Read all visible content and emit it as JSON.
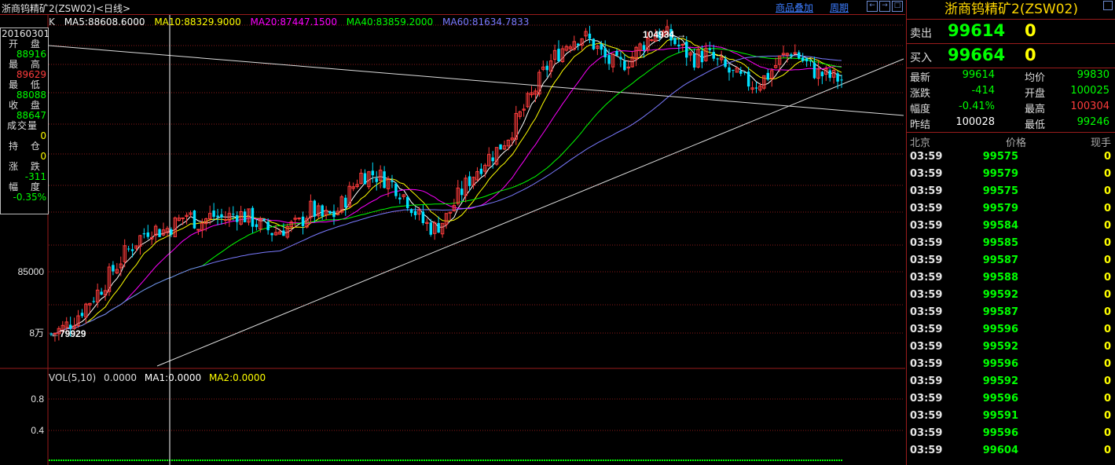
{
  "header": {
    "title": "浙商钨精矿2(ZSW02)<日线>",
    "link_overlay": "商品叠加",
    "link_period": "周期",
    "btn_prev": "←",
    "btn_next": "→",
    "btn_close": "□"
  },
  "legend": {
    "k": "K",
    "ma5": "MA5:88608.6000",
    "ma10": "MA10:88329.9000",
    "ma20": "MA20:87447.1500",
    "ma40": "MA40:83859.2000",
    "ma60": "MA60:81634.7833"
  },
  "colors": {
    "up": "#ff3c3c",
    "down": "#00e0ff",
    "ma5": "#ffffff",
    "ma10": "#ffff00",
    "ma20": "#ff00ff",
    "ma40": "#00ff00",
    "ma60": "#7a7aff",
    "grid": "#8b1a1a"
  },
  "vol_legend": {
    "label": "VOL(5,10)",
    "value": "0.0000",
    "ma1": "MA1:0.0000",
    "ma2": "MA2:0.0000"
  },
  "info_box": {
    "date": "20160301",
    "open_label": "开 盘",
    "open": "88916",
    "high_label": "最 高",
    "high": "89629",
    "low_label": "最 低",
    "low": "88088",
    "close_label": "收 盘",
    "close": "88647",
    "volume_label": "成交量",
    "volume": "0",
    "oi_label": "持 仓",
    "oi": "0",
    "change_label": "涨 跌",
    "change": "-311",
    "amp_label": "幅 度",
    "amp": "-0.35%"
  },
  "chart_data": {
    "type": "candlestick",
    "y_ticks": [
      "85000",
      "8万"
    ],
    "y_tick_values": [
      85000,
      80000
    ],
    "vol_ticks": [
      "0.8",
      "0.4"
    ],
    "vol_tick_values": [
      0.8,
      0.4
    ],
    "high_marker": "104934",
    "low_marker": "79929",
    "ma_lines": [
      "MA5",
      "MA10",
      "MA20",
      "MA40",
      "MA60"
    ],
    "close_path": [
      79929,
      80400,
      81300,
      82500,
      83600,
      85100,
      86500,
      87600,
      88600,
      88300,
      88900,
      89700,
      88900,
      89600,
      89300,
      89800,
      89400,
      88700,
      88200,
      88600,
      88800,
      90100,
      89400,
      89700,
      91200,
      92900,
      93000,
      92600,
      91900,
      90700,
      89100,
      88500,
      89400,
      91200,
      92700,
      94000,
      94800,
      96100,
      97800,
      99500,
      101500,
      102800,
      103900,
      104300,
      103500,
      102200,
      101800,
      102500,
      103700,
      104600,
      104200,
      103200,
      102400,
      102800,
      102000,
      101200,
      100600,
      100300,
      101000,
      102300,
      103100,
      102100,
      101200,
      100900,
      100700
    ],
    "volume": 0
  },
  "panel": {
    "title": "浙商钨精矿2(ZSW02)",
    "ask_label": "卖出",
    "ask_price": "99614",
    "ask_qty": "0",
    "bid_label": "买入",
    "bid_price": "99664",
    "bid_qty": "0",
    "stats": [
      {
        "k1": "最新",
        "v1": "99614",
        "c1": "#00ff00",
        "k2": "均价",
        "v2": "99830",
        "c2": "#00ff00"
      },
      {
        "k1": "涨跌",
        "v1": "-414",
        "c1": "#00ff00",
        "k2": "开盘",
        "v2": "100025",
        "c2": "#00ff00"
      },
      {
        "k1": "幅度",
        "v1": "-0.41%",
        "c1": "#00ff00",
        "k2": "最高",
        "v2": "100304",
        "c2": "#ff3c3c"
      },
      {
        "k1": "昨结",
        "v1": "100028",
        "c1": "#ffffff",
        "k2": "最低",
        "v2": "99246",
        "c2": "#00ff00"
      }
    ],
    "trade_header": {
      "time": "北京",
      "price": "价格",
      "qty": "现手"
    },
    "trades": [
      {
        "time": "03:59",
        "price": "99575",
        "qty": "0"
      },
      {
        "time": "03:59",
        "price": "99579",
        "qty": "0"
      },
      {
        "time": "03:59",
        "price": "99575",
        "qty": "0"
      },
      {
        "time": "03:59",
        "price": "99579",
        "qty": "0"
      },
      {
        "time": "03:59",
        "price": "99584",
        "qty": "0"
      },
      {
        "time": "03:59",
        "price": "99585",
        "qty": "0"
      },
      {
        "time": "03:59",
        "price": "99587",
        "qty": "0"
      },
      {
        "time": "03:59",
        "price": "99588",
        "qty": "0"
      },
      {
        "time": "03:59",
        "price": "99592",
        "qty": "0"
      },
      {
        "time": "03:59",
        "price": "99587",
        "qty": "0"
      },
      {
        "time": "03:59",
        "price": "99596",
        "qty": "0"
      },
      {
        "time": "03:59",
        "price": "99592",
        "qty": "0"
      },
      {
        "time": "03:59",
        "price": "99596",
        "qty": "0"
      },
      {
        "time": "03:59",
        "price": "99592",
        "qty": "0"
      },
      {
        "time": "03:59",
        "price": "99596",
        "qty": "0"
      },
      {
        "time": "03:59",
        "price": "99591",
        "qty": "0"
      },
      {
        "time": "03:59",
        "price": "99596",
        "qty": "0"
      },
      {
        "time": "03:59",
        "price": "99604",
        "qty": "0"
      }
    ]
  }
}
